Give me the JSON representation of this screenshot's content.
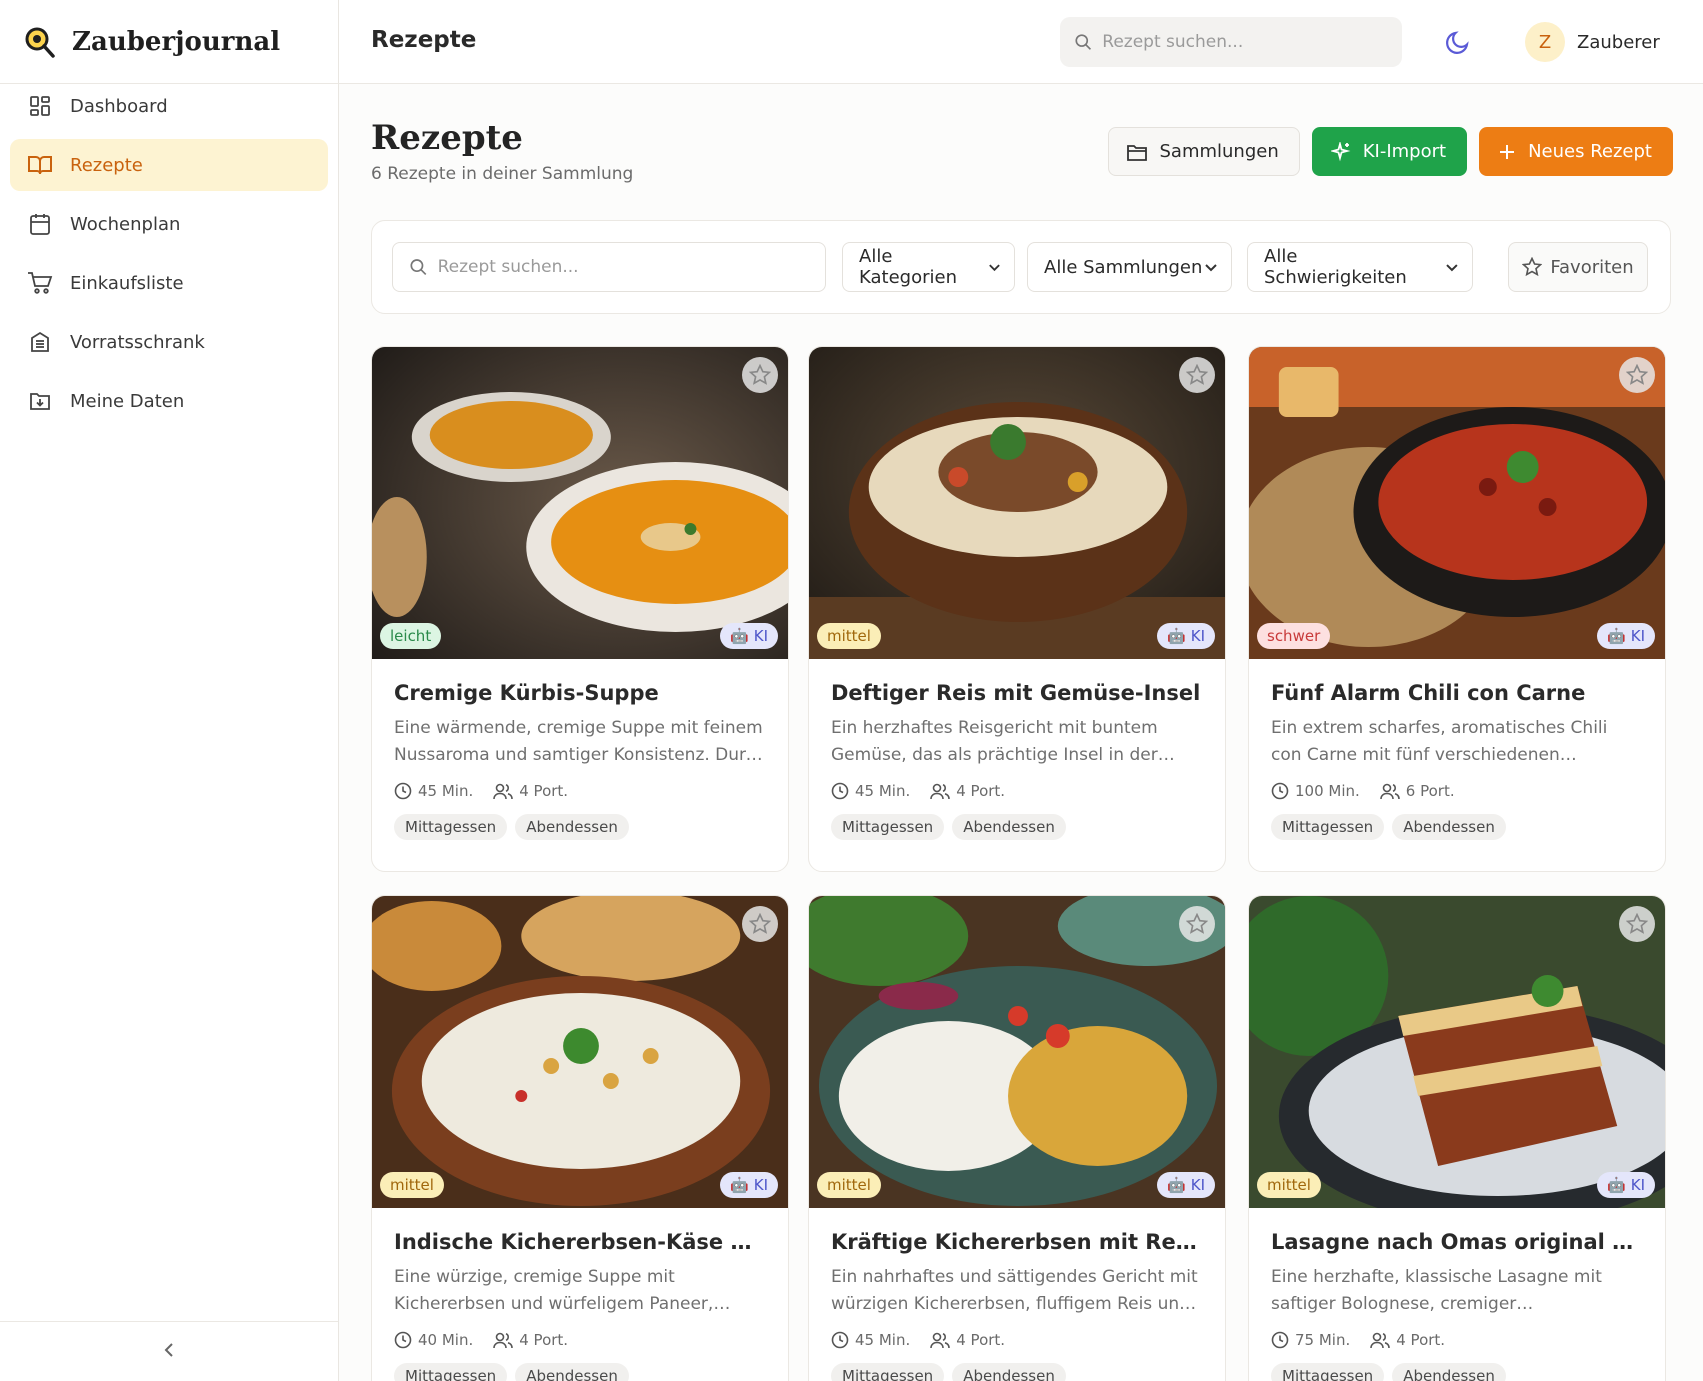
{
  "app": {
    "name": "Zauberjournal"
  },
  "sidebar": {
    "items": [
      {
        "label": "Dashboard",
        "icon": "dashboard-icon",
        "active": false
      },
      {
        "label": "Rezepte",
        "icon": "book-icon",
        "active": true
      },
      {
        "label": "Wochenplan",
        "icon": "calendar-icon",
        "active": false
      },
      {
        "label": "Einkaufsliste",
        "icon": "cart-icon",
        "active": false
      },
      {
        "label": "Vorratsschrank",
        "icon": "cabinet-icon",
        "active": false
      },
      {
        "label": "Meine Daten",
        "icon": "folder-download-icon",
        "active": false
      }
    ],
    "collapse_icon": "chevron-left-icon"
  },
  "topbar": {
    "title": "Rezepte",
    "search_placeholder": "Rezept suchen...",
    "theme_icon": "moon-icon",
    "user": {
      "initial": "Z",
      "name": "Zauberer"
    }
  },
  "page": {
    "title": "Rezepte",
    "subtitle": "6 Rezepte in deiner Sammlung",
    "actions": {
      "collections": "Sammlungen",
      "ai_import": "KI-Import",
      "new_recipe": "Neues Rezept"
    }
  },
  "filters": {
    "search_placeholder": "Rezept suchen...",
    "category": "Alle Kategorien",
    "collection": "Alle Sammlungen",
    "difficulty": "Alle Schwierigkeiten",
    "favorites": "Favoriten"
  },
  "colors": {
    "accent": "#ed7d14",
    "success": "#1fa34a",
    "active_bg": "#fdf3d2"
  },
  "recipes": [
    {
      "title": "Cremige Kürbis-Suppe",
      "description": "Eine wärmende, cremige Suppe mit feinem Nussaroma und samtiger Konsistenz. Durch geröstete Kürbiskerne wird sie zum Genuss.",
      "difficulty": "leicht",
      "ai_badge": "🤖 KI",
      "time": "45 Min.",
      "portions": "4 Port.",
      "tags": [
        "Mittagessen",
        "Abendessen"
      ]
    },
    {
      "title": "Deftiger Reis mit Gemüse-Insel",
      "description": "Ein herzhaftes Reisgericht mit buntem Gemüse, das als prächtige Insel in der Mitte thront.",
      "difficulty": "mittel",
      "ai_badge": "🤖 KI",
      "time": "45 Min.",
      "portions": "4 Port.",
      "tags": [
        "Mittagessen",
        "Abendessen"
      ]
    },
    {
      "title": "Fünf Alarm Chili con Carne",
      "description": "Ein extrem scharfes, aromatisches Chili con Carne mit fünf verschiedenen Chilisorten, Bohnen und Hackfleisch.",
      "difficulty": "schwer",
      "ai_badge": "🤖 KI",
      "time": "100 Min.",
      "portions": "6 Port.",
      "tags": [
        "Mittagessen",
        "Abendessen"
      ]
    },
    {
      "title": "Indische Kichererbsen-Käse Suppe",
      "description": "Eine würzige, cremige Suppe mit Kichererbsen und würfeligem Paneer, verfeinert mit Gewürzen.",
      "difficulty": "mittel",
      "ai_badge": "🤖 KI",
      "time": "40 Min.",
      "portions": "4 Port.",
      "tags": [
        "Mittagessen",
        "Abendessen"
      ]
    },
    {
      "title": "Kräftige Kichererbsen mit Reis und Gemüse",
      "description": "Ein nahrhaftes und sättigendes Gericht mit würzigen Kichererbsen, fluffigem Reis und frischem Gemüse.",
      "difficulty": "mittel",
      "ai_badge": "🤖 KI",
      "time": "45 Min.",
      "portions": "4 Port.",
      "tags": [
        "Mittagessen",
        "Abendessen"
      ]
    },
    {
      "title": "Lasagne nach Omas original Rezept",
      "description": "Eine herzhafte, klassische Lasagne mit saftiger Bolognese, cremiger Béchamelsauce und viel Käse.",
      "difficulty": "mittel",
      "ai_badge": "🤖 KI",
      "time": "75 Min.",
      "portions": "4 Port.",
      "tags": [
        "Mittagessen",
        "Abendessen"
      ]
    }
  ]
}
